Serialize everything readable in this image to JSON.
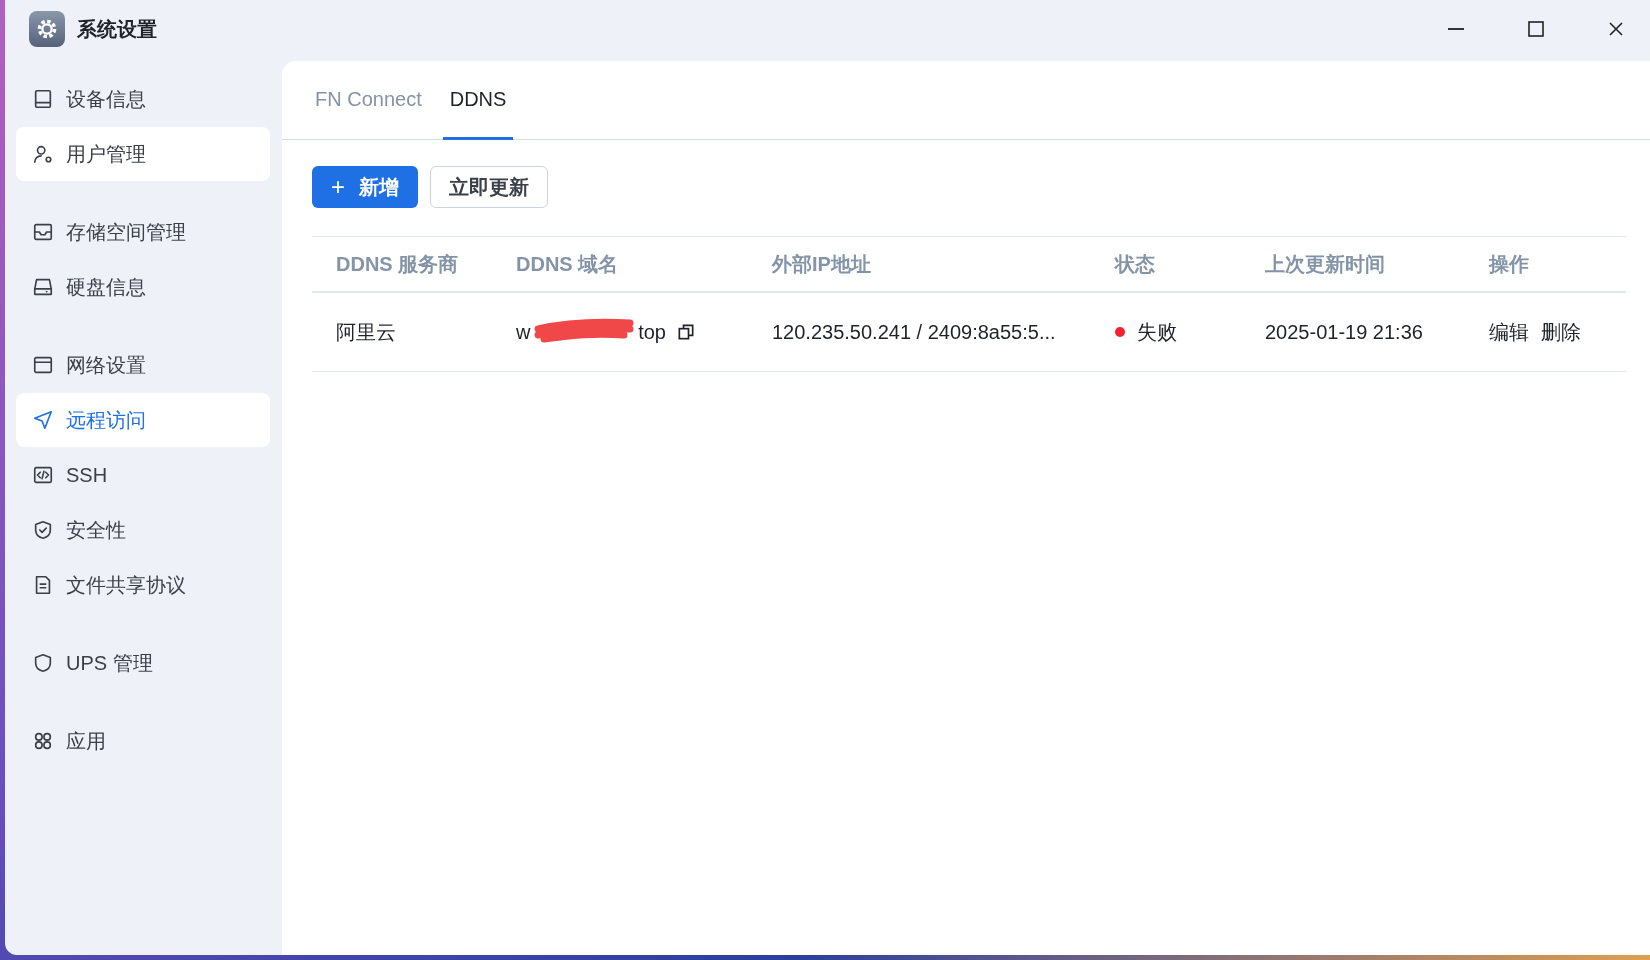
{
  "window": {
    "title": "系统设置"
  },
  "sidebar": {
    "groups": [
      {
        "items": [
          {
            "label": "设备信息",
            "selected": false,
            "hovered": false
          },
          {
            "label": "用户管理",
            "selected": false,
            "hovered": true
          }
        ]
      },
      {
        "items": [
          {
            "label": "存储空间管理",
            "selected": false,
            "hovered": false
          },
          {
            "label": "硬盘信息",
            "selected": false,
            "hovered": false
          }
        ]
      },
      {
        "items": [
          {
            "label": "网络设置",
            "selected": false,
            "hovered": false
          },
          {
            "label": "远程访问",
            "selected": true,
            "hovered": false
          },
          {
            "label": "SSH",
            "selected": false,
            "hovered": false
          },
          {
            "label": "安全性",
            "selected": false,
            "hovered": false
          },
          {
            "label": "文件共享协议",
            "selected": false,
            "hovered": false
          }
        ]
      },
      {
        "items": [
          {
            "label": "UPS 管理",
            "selected": false,
            "hovered": false
          }
        ]
      },
      {
        "items": [
          {
            "label": "应用",
            "selected": false,
            "hovered": false
          }
        ]
      }
    ]
  },
  "tabs": [
    {
      "label": "FN Connect",
      "selected": false
    },
    {
      "label": "DDNS",
      "selected": true
    }
  ],
  "toolbar": {
    "add_button": {
      "icon": "+",
      "label": "新增"
    },
    "update_button": {
      "label": "立即更新"
    }
  },
  "table": {
    "columns": [
      "DDNS 服务商",
      "DDNS 域名",
      "外部IP地址",
      "状态",
      "上次更新时间",
      "操作"
    ],
    "rows": [
      {
        "provider": "阿里云",
        "domain_start": "w",
        "domain_end": "top",
        "domain_redacted": true,
        "ip": "120.235.50.241 / 2409:8a55:5...",
        "status": "失败",
        "color": "#f5222d",
        "updated": "2025-01-19 21:36",
        "actions": [
          "编辑",
          "删除"
        ]
      }
    ]
  }
}
